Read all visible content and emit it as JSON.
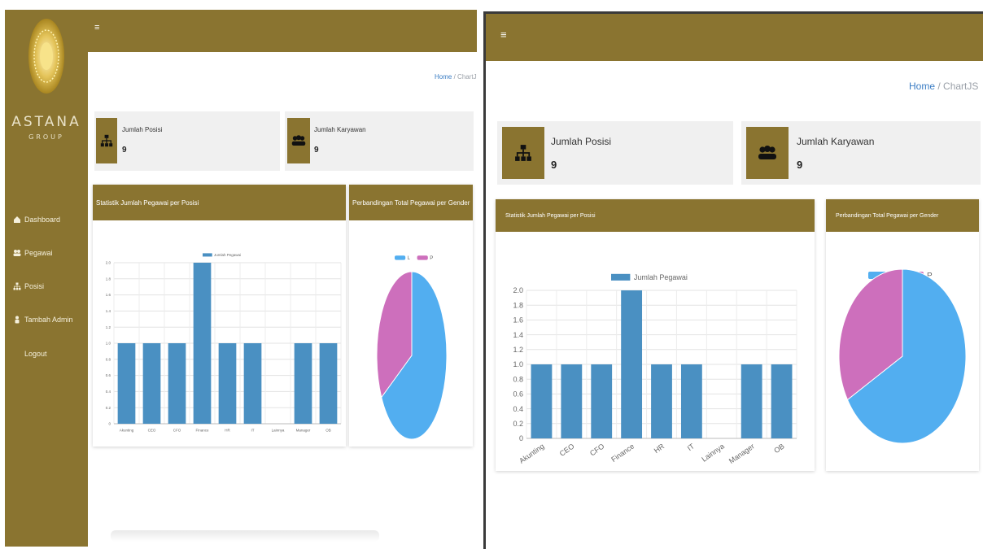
{
  "brand": {
    "name": "ASTANA",
    "sub": "GROUP"
  },
  "sidebar": {
    "items": [
      {
        "label": "Dashboard",
        "icon": "home-icon"
      },
      {
        "label": "Pegawai",
        "icon": "users-icon"
      },
      {
        "label": "Posisi",
        "icon": "sitemap-icon"
      },
      {
        "label": "Tambah Admin",
        "icon": "user-plus-icon"
      },
      {
        "label": "Logout",
        "icon": ""
      }
    ]
  },
  "topbar": {
    "menu_glyph": "≡"
  },
  "breadcrumb": {
    "home": "Home",
    "sep": "/",
    "current": "ChartJS"
  },
  "cards": {
    "posisi": {
      "label": "Jumlah Posisi",
      "value": "9"
    },
    "karyawan": {
      "label": "Jumlah Karyawan",
      "value": "9"
    }
  },
  "panels": {
    "bar_title": "Statistik Jumlah Pegawai per Posisi",
    "pie_title": "Perbandingan Total Pegawai per Gender"
  },
  "colors": {
    "olive": "#8a7430",
    "bar": "#4a90c2",
    "pie_l": "#52aef0",
    "pie_p": "#cd6fbc"
  },
  "chart_data": [
    {
      "type": "bar",
      "categories": [
        "Akunting",
        "CEO",
        "CFO",
        "Finance",
        "HR",
        "IT",
        "Lainnya",
        "Manager",
        "OB"
      ],
      "series": [
        {
          "name": "Jumlah Pegawai",
          "values": [
            1,
            1,
            1,
            2,
            1,
            1,
            0,
            1,
            1
          ]
        }
      ],
      "ylim": [
        0,
        2
      ],
      "yticks": [
        "0",
        "0.2",
        "0.4",
        "0.6",
        "0.8",
        "1.0",
        "1.2",
        "1.4",
        "1.6",
        "1.8",
        "2.0"
      ],
      "legend": "top",
      "grid": true
    },
    {
      "type": "pie",
      "labels": [
        "L",
        "P"
      ],
      "values": [
        6,
        3
      ],
      "legend": "top"
    }
  ]
}
